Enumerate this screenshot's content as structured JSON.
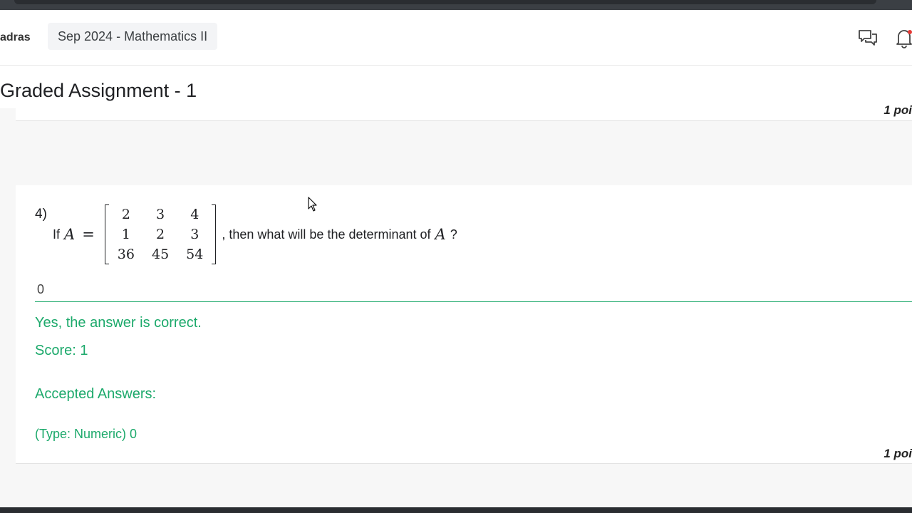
{
  "header": {
    "brand": "adras",
    "course": "Sep 2024 - Mathematics II",
    "icons": [
      "chat-icon",
      "bell-icon"
    ]
  },
  "page": {
    "title": "Graded Assignment - 1",
    "points_label": "1 poi"
  },
  "question": {
    "number": "4)",
    "prefix": "If",
    "var": "A",
    "eq": "=",
    "matrix": [
      [
        "2",
        "3",
        "4"
      ],
      [
        "1",
        "2",
        "3"
      ],
      [
        "36",
        "45",
        "54"
      ]
    ],
    "tail": ", then what will be the determinant of",
    "tail_var": "A",
    "tail_end": "?"
  },
  "answer": {
    "value": "0",
    "feedback": "Yes, the answer is correct.",
    "score": "Score: 1",
    "accepted_label": "Accepted Answers:",
    "accepted_value": "(Type: Numeric) 0",
    "points_label": "1 poi"
  },
  "colors": {
    "correct": "#1ca96b"
  }
}
